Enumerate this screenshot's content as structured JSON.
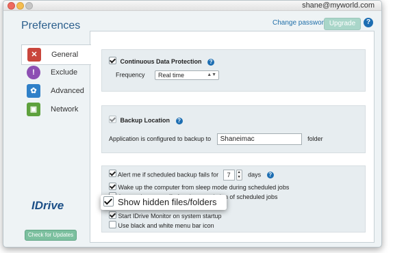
{
  "window": {
    "user_email": "shane@myworld.com",
    "title": "Preferences",
    "change_password": "Change password",
    "upgrade": "Upgrade",
    "help_icon": "?"
  },
  "sidebar": {
    "items": [
      {
        "label": "General",
        "icon": "tools-icon",
        "color": "#c9463c"
      },
      {
        "label": "Exclude",
        "icon": "exclamation-icon",
        "color": "#8d4fb3"
      },
      {
        "label": "Advanced",
        "icon": "gear-icon",
        "color": "#2f80c8"
      },
      {
        "label": "Network",
        "icon": "network-icon",
        "color": "#5ea13d"
      }
    ],
    "logo": "IDrive",
    "check_updates": "Check for Updates"
  },
  "cdp": {
    "label": "Continuous Data Protection",
    "checked": true,
    "frequency_label": "Frequency",
    "frequency_value": "Real time"
  },
  "backup": {
    "label": "Backup Location",
    "text_before": "Application is configured to backup to",
    "location": "Shaneimac",
    "text_after": "folder"
  },
  "options": {
    "alert_before": "Alert me if scheduled backup fails for",
    "alert_days": "7",
    "alert_after": "days",
    "wake": "Wake up the computer from sleep mode during scheduled jobs",
    "poweroff": "Automatic power off after the completion of scheduled jobs",
    "hidden_files": "Show hidden files/folders",
    "monitor": "Start IDrive Monitor on system startup",
    "bw_icon": "Use black and white menu bar icon"
  }
}
